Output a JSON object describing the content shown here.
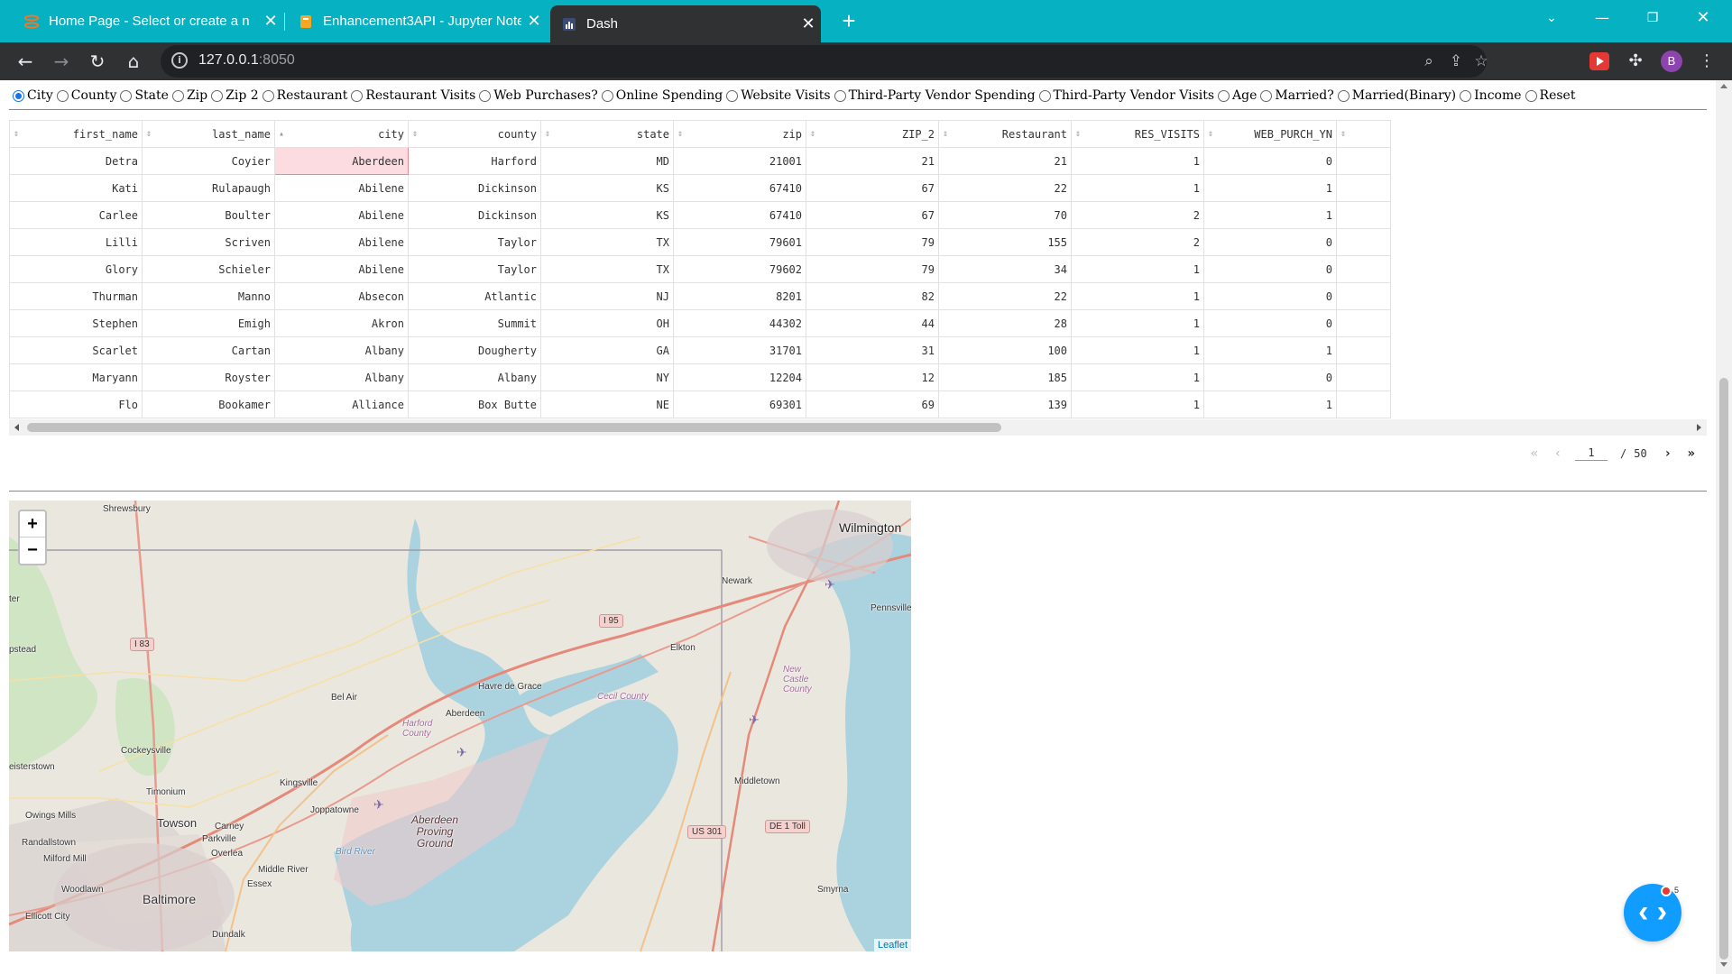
{
  "browser": {
    "tabs": [
      {
        "title": "Home Page - Select or create a n",
        "icon": "jupyter-icon",
        "active": false
      },
      {
        "title": "Enhancement3API - Jupyter Note",
        "icon": "notebook-icon",
        "active": false
      },
      {
        "title": "Dash",
        "icon": "dash-icon",
        "active": true
      }
    ],
    "url_host": "127.0.0.1",
    "url_port": ":8050",
    "profile_initial": "B"
  },
  "filters": {
    "options": [
      "City",
      "County",
      "State",
      "Zip",
      "Zip 2",
      "Restaurant",
      "Restaurant Visits",
      "Web Purchases?",
      "Online Spending",
      "Website Visits",
      "Third-Party Vendor Spending",
      "Third-Party Vendor Visits",
      "Age",
      "Married?",
      "Married(Binary)",
      "Income",
      "Reset"
    ],
    "selected": "City"
  },
  "table": {
    "columns": [
      "first_name",
      "last_name",
      "city",
      "county",
      "state",
      "zip",
      "ZIP_2",
      "Restaurant",
      "RES_VISITS",
      "WEB_PURCH_YN"
    ],
    "sorted_column": "city",
    "active_cell": {
      "row": 0,
      "col": 2
    },
    "rows": [
      [
        "Detra",
        "Coyier",
        "Aberdeen",
        "Harford",
        "MD",
        "21001",
        "21",
        "21",
        "1",
        "0"
      ],
      [
        "Kati",
        "Rulapaugh",
        "Abilene",
        "Dickinson",
        "KS",
        "67410",
        "67",
        "22",
        "1",
        "1"
      ],
      [
        "Carlee",
        "Boulter",
        "Abilene",
        "Dickinson",
        "KS",
        "67410",
        "67",
        "70",
        "2",
        "1"
      ],
      [
        "Lilli",
        "Scriven",
        "Abilene",
        "Taylor",
        "TX",
        "79601",
        "79",
        "155",
        "2",
        "0"
      ],
      [
        "Glory",
        "Schieler",
        "Abilene",
        "Taylor",
        "TX",
        "79602",
        "79",
        "34",
        "1",
        "0"
      ],
      [
        "Thurman",
        "Manno",
        "Absecon",
        "Atlantic",
        "NJ",
        "8201",
        "82",
        "22",
        "1",
        "0"
      ],
      [
        "Stephen",
        "Emigh",
        "Akron",
        "Summit",
        "OH",
        "44302",
        "44",
        "28",
        "1",
        "0"
      ],
      [
        "Scarlet",
        "Cartan",
        "Albany",
        "Dougherty",
        "GA",
        "31701",
        "31",
        "100",
        "1",
        "1"
      ],
      [
        "Maryann",
        "Royster",
        "Albany",
        "Albany",
        "NY",
        "12204",
        "12",
        "185",
        "1",
        "0"
      ],
      [
        "Flo",
        "Bookamer",
        "Alliance",
        "Box Butte",
        "NE",
        "69301",
        "69",
        "139",
        "1",
        "1"
      ]
    ]
  },
  "pagination": {
    "current": "1",
    "separator": "/",
    "total": "50"
  },
  "map": {
    "zoom_in": "+",
    "zoom_out": "−",
    "attribution": "Leaflet",
    "labels": {
      "wilmington": "Wilmington",
      "shrewsbury": "Shrewsbury",
      "newark": "Newark",
      "pennsville": "Pennsville",
      "elkton": "Elkton",
      "bel_air": "Bel Air",
      "havre": "Havre de Grace",
      "aberdeen": "Aberdeen",
      "cecil": "Cecil County",
      "harford": "Harford County",
      "new_castle": "New Castle County",
      "cockeysville": "Cockeysville",
      "kingsville": "Kingsville",
      "timonium": "Timonium",
      "middletown": "Middletown",
      "owings": "Owings Mills",
      "towson": "Towson",
      "carney": "Carney",
      "joppatowne": "Joppatowne",
      "parkville": "Parkville",
      "overlea": "Overlea",
      "randallstown": "Randallstown",
      "milford": "Milford Mill",
      "middle_river": "Middle River",
      "bird_river": "Bird River",
      "essex": "Essex",
      "woodlawn": "Woodlawn",
      "baltimore": "Baltimore",
      "ellicott": "Ellicott City",
      "dundalk": "Dundalk",
      "smyrna": "Smyrna",
      "reisterstown": "eisterstown",
      "hampstead": "pstead",
      "westminster": "ter",
      "apg": "Aberdeen Proving Ground",
      "i83": "I 83",
      "i95": "I 95",
      "us301": "US 301",
      "de1": "DE 1 Toll"
    }
  },
  "dev_tools": {
    "badge_count": "5"
  },
  "colors": {
    "tabbar": "#06b1c2",
    "toolbar": "#2f3133",
    "active_cell_bg": "#fcdce0",
    "dev_button": "#119dff",
    "water": "#aad3df"
  }
}
